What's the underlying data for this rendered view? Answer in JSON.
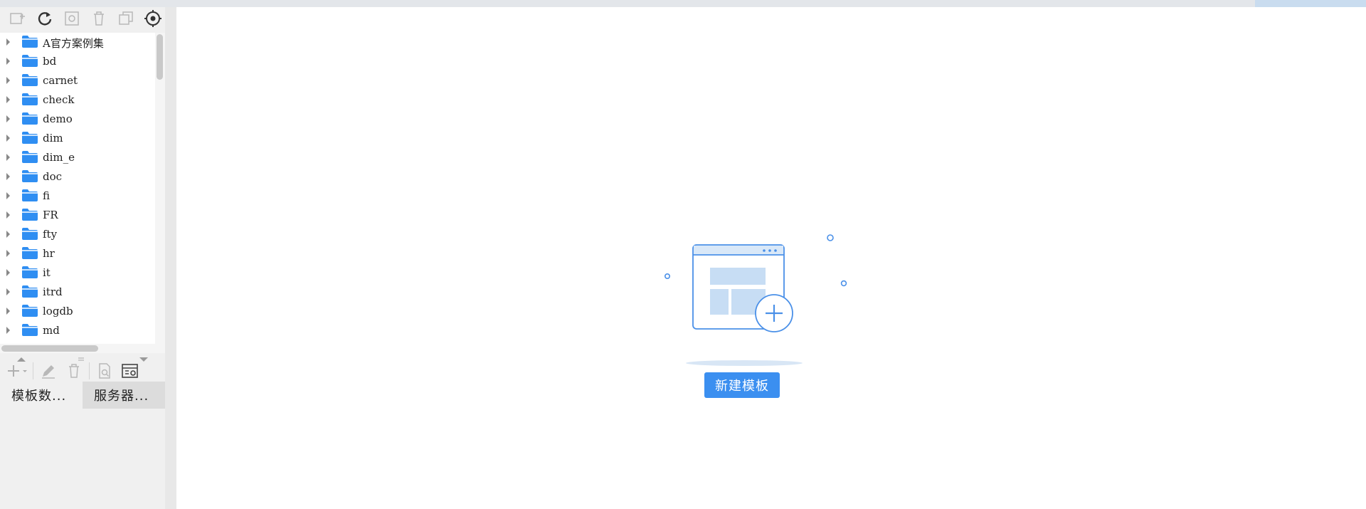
{
  "tree": {
    "items": [
      {
        "label": "A官方案例集"
      },
      {
        "label": "bd"
      },
      {
        "label": "carnet"
      },
      {
        "label": "check"
      },
      {
        "label": "demo"
      },
      {
        "label": "dim"
      },
      {
        "label": "dim_e"
      },
      {
        "label": "doc"
      },
      {
        "label": "fi"
      },
      {
        "label": "FR"
      },
      {
        "label": "fty"
      },
      {
        "label": "hr"
      },
      {
        "label": "it"
      },
      {
        "label": "itrd"
      },
      {
        "label": "logdb"
      },
      {
        "label": "md"
      }
    ]
  },
  "tabs": [
    {
      "label": "模板数..."
    },
    {
      "label": "服务器..."
    }
  ],
  "main": {
    "new_template_label": "新建模板"
  },
  "colors": {
    "accent": "#3b8ff0",
    "folder": "#2f8ef2"
  }
}
